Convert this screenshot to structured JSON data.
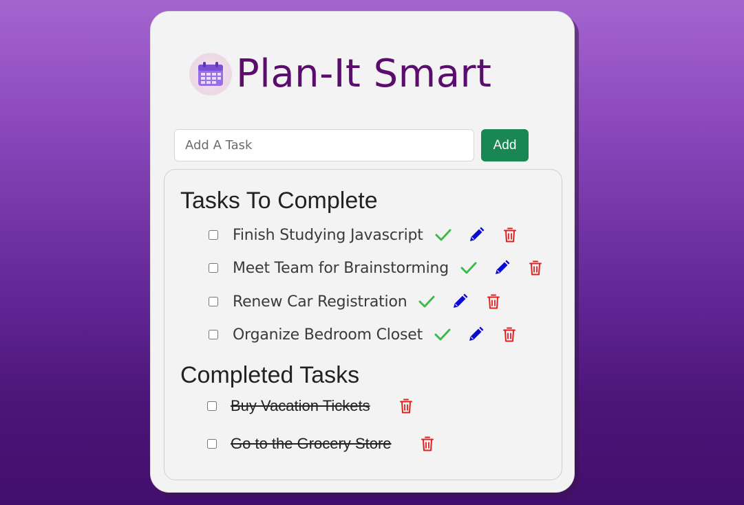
{
  "app": {
    "title": "Plan-It Smart",
    "logo_icon": "calendar-icon"
  },
  "add_task": {
    "placeholder": "Add A Task",
    "value": "",
    "button_label": "Add"
  },
  "todo_section": {
    "heading": "Tasks To Complete",
    "tasks": [
      {
        "label": "Finish Studying Javascript",
        "checked": false
      },
      {
        "label": "Meet Team for Brainstorming",
        "checked": false
      },
      {
        "label": "Renew Car Registration",
        "checked": false
      },
      {
        "label": "Organize Bedroom Closet",
        "checked": false
      }
    ],
    "actions": [
      "check-icon",
      "pencil-icon",
      "trash-icon"
    ]
  },
  "completed_section": {
    "heading": "Completed Tasks",
    "tasks": [
      {
        "label": "Buy Vacation Tickets",
        "checked": false
      },
      {
        "label": "Go to the Grocery Store",
        "checked": false
      }
    ],
    "actions": [
      "trash-icon"
    ]
  },
  "colors": {
    "brand": "#5b0d6e",
    "add_button": "#198754",
    "complete_icon": "#3cba4c",
    "edit_icon": "#0a0ad2",
    "delete_icon": "#e01f1f"
  }
}
